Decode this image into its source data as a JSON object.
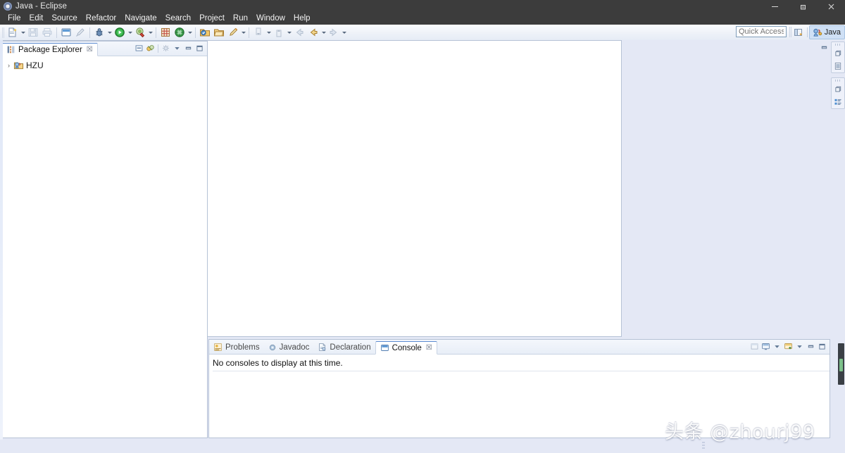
{
  "window": {
    "title": "Java - Eclipse",
    "icon": "eclipse-icon",
    "minimize": "─",
    "maximize": "❐",
    "close": "✕"
  },
  "menubar": {
    "items": [
      {
        "label": "File",
        "name": "menu-file"
      },
      {
        "label": "Edit",
        "name": "menu-edit"
      },
      {
        "label": "Source",
        "name": "menu-source"
      },
      {
        "label": "Refactor",
        "name": "menu-refactor"
      },
      {
        "label": "Navigate",
        "name": "menu-navigate"
      },
      {
        "label": "Search",
        "name": "menu-search"
      },
      {
        "label": "Project",
        "name": "menu-project"
      },
      {
        "label": "Run",
        "name": "menu-run"
      },
      {
        "label": "Window",
        "name": "menu-window"
      },
      {
        "label": "Help",
        "name": "menu-help"
      }
    ]
  },
  "toolbar": {
    "buttons": [
      {
        "name": "new-wizard-icon",
        "title": "New"
      },
      {
        "name": "save-icon",
        "title": "Save"
      },
      {
        "name": "print-icon",
        "title": "Print"
      },
      {
        "name": "toggle-console-icon",
        "title": "Open Console"
      },
      {
        "name": "toggle-mark-occurrences-icon",
        "title": "Toggle Mark Occurrences"
      },
      {
        "name": "debug-icon",
        "title": "Debug"
      },
      {
        "name": "run-icon",
        "title": "Run"
      },
      {
        "name": "external-tools-icon",
        "title": "External Tools"
      },
      {
        "name": "new-java-package-icon",
        "title": "New Java Package"
      },
      {
        "name": "new-java-class-icon",
        "title": "New Java Class"
      },
      {
        "name": "open-type-icon",
        "title": "Open Type"
      },
      {
        "name": "open-task-icon",
        "title": "Open Task"
      },
      {
        "name": "search-icon",
        "title": "Search"
      },
      {
        "name": "next-annotation-icon",
        "title": "Next Annotation"
      },
      {
        "name": "previous-annotation-icon",
        "title": "Previous Annotation"
      },
      {
        "name": "back-icon",
        "title": "Back"
      },
      {
        "name": "last-edit-location-icon",
        "title": "Last Edit Location"
      },
      {
        "name": "forward-icon",
        "title": "Forward"
      }
    ],
    "quick_access_placeholder": "Quick Access",
    "quick_access_value": "",
    "open-perspective-icon": "open-perspective-icon",
    "perspective": {
      "label": "Java",
      "icon": "java-perspective-icon"
    }
  },
  "package_explorer": {
    "tab_label": "Package Explorer",
    "tab_icon": "package-explorer-icon",
    "close_glyph": "☒",
    "tools": [
      {
        "name": "collapse-all-icon"
      },
      {
        "name": "link-with-editor-icon"
      },
      {
        "name": "view-menu-icon"
      },
      {
        "name": "view-dropdown-icon"
      },
      {
        "name": "minimize-icon"
      },
      {
        "name": "maximize-icon"
      }
    ],
    "tree": [
      {
        "label": "HZU",
        "icon": "java-project-icon",
        "twisty": "›",
        "expanded": false
      }
    ]
  },
  "editor_area": {
    "empty": true,
    "tools": [
      {
        "name": "editor-minimize-icon"
      },
      {
        "name": "editor-maximize-icon"
      }
    ]
  },
  "console_part": {
    "tabs": [
      {
        "label": "Problems",
        "icon": "problems-icon",
        "active": false,
        "name": "tab-problems"
      },
      {
        "label": "Javadoc",
        "icon": "javadoc-icon",
        "active": false,
        "name": "tab-javadoc"
      },
      {
        "label": "Declaration",
        "icon": "declaration-icon",
        "active": false,
        "name": "tab-declaration"
      },
      {
        "label": "Console",
        "icon": "console-icon",
        "active": true,
        "name": "tab-console"
      }
    ],
    "close_glyph": "☒",
    "message": "No consoles to display at this time.",
    "tools": [
      {
        "name": "open-console-icon"
      },
      {
        "name": "display-selected-console-icon"
      },
      {
        "name": "display-selected-console-dropdown-icon"
      },
      {
        "name": "new-console-view-icon"
      },
      {
        "name": "new-console-view-dropdown-icon"
      },
      {
        "name": "console-minimize-icon"
      },
      {
        "name": "console-maximize-icon"
      }
    ]
  },
  "fast_view_bar": {
    "stacks": [
      {
        "name": "fastview-stack-outline",
        "buttons": [
          {
            "name": "restore-icon"
          },
          {
            "name": "outline-view-icon"
          }
        ]
      },
      {
        "name": "fastview-stack-task-list",
        "buttons": [
          {
            "name": "restore-icon"
          },
          {
            "name": "task-list-view-icon"
          }
        ]
      }
    ]
  },
  "status_bar": {
    "resize_grip": "resize-grip"
  },
  "watermark": {
    "text": "头条 @zhourj99"
  },
  "colors": {
    "titlebar_bg": "#3c3c3c",
    "workbench_bg": "#e4e8f5",
    "part_border": "#b6c2d6",
    "active_tab_top": "#5b8bd0",
    "perspective_active": "#cfe0f5",
    "accent_green": "#7cc08a"
  }
}
